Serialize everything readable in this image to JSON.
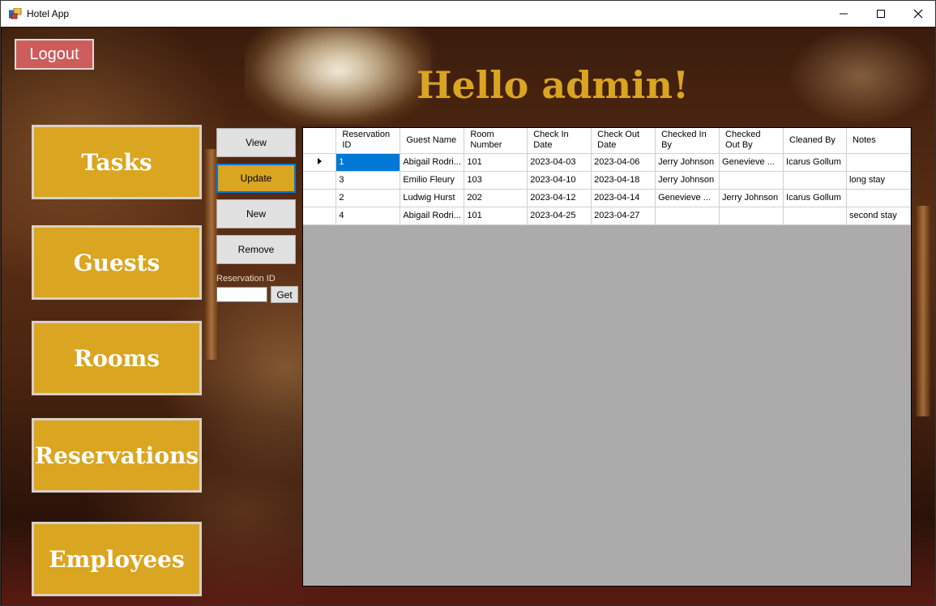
{
  "window": {
    "title": "Hotel App",
    "controls": {
      "minimize": "—",
      "maximize": "☐",
      "close": "✕"
    }
  },
  "header": {
    "logout_label": "Logout",
    "greeting": "Hello admin!"
  },
  "nav": {
    "tasks": "Tasks",
    "guests": "Guests",
    "rooms": "Rooms",
    "reservations": "Reservations",
    "employees": "Employees"
  },
  "actions": {
    "view": "View",
    "update": "Update",
    "new": "New",
    "remove": "Remove",
    "reservation_id_label": "Reservation ID",
    "reservation_id_value": "",
    "get": "Get"
  },
  "grid": {
    "columns": [
      "Reservation ID",
      "Guest Name",
      "Room Number",
      "Check In Date",
      "Check Out Date",
      "Checked In By",
      "Checked Out By",
      "Cleaned By",
      "Notes"
    ],
    "rows": [
      [
        "1",
        "Abigail Rodri...",
        "101",
        "2023-04-03",
        "2023-04-06",
        "Jerry Johnson",
        "Genevieve ...",
        "Icarus Gollum",
        ""
      ],
      [
        "3",
        "Emilio Fleury",
        "103",
        "2023-04-10",
        "2023-04-18",
        "Jerry Johnson",
        "",
        "",
        "long stay"
      ],
      [
        "2",
        "Ludwig Hurst",
        "202",
        "2023-04-12",
        "2023-04-14",
        "Genevieve ...",
        "Jerry Johnson",
        "Icarus Gollum",
        ""
      ],
      [
        "4",
        "Abigail Rodri...",
        "101",
        "2023-04-25",
        "2023-04-27",
        "",
        "",
        "",
        "second stay"
      ]
    ]
  },
  "colors": {
    "gold": "#daa520",
    "logout": "#cd5c5c",
    "selection": "#0078d7",
    "grid_bg": "#ababab"
  }
}
